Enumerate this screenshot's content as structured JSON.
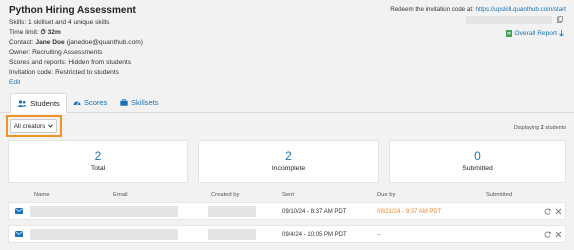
{
  "title": "Python Hiring Assessment",
  "info": {
    "skills": "Skills: 1 skillset and 4 unique skills",
    "time_limit_label": "Time limit:",
    "time_limit_value": "32m",
    "contact_label": "Contact:",
    "contact_name": "Jane Doe",
    "contact_email": "(janedoe@quanthub.com)",
    "owner": "Owner: Recruiting Assessments",
    "scores_reports": "Scores and reports: Hidden from students",
    "invitation_code": "Invitation code: Restricted to students",
    "edit": "Edit"
  },
  "redeem": {
    "label": "Redeem the invitation code at:",
    "url": "https://upskill.quanthub.com/start"
  },
  "overall_report": "Overall Report",
  "tabs": [
    {
      "label": "Students"
    },
    {
      "label": "Scores"
    },
    {
      "label": "Skillsets"
    }
  ],
  "filter": {
    "label": "All creators"
  },
  "displaying": {
    "prefix": "Displaying",
    "count": "2",
    "suffix": "students"
  },
  "stats": [
    {
      "value": "2",
      "label": "Total"
    },
    {
      "value": "2",
      "label": "Incomplete"
    },
    {
      "value": "0",
      "label": "Submitted"
    }
  ],
  "columns": [
    "Name",
    "Email",
    "Created by",
    "Sent",
    "Due by",
    "Submitted"
  ],
  "rows": [
    {
      "sent": "09/10/24 - 8:37 AM PDT",
      "due": "09/21/24 - 9:37 AM PDT",
      "submitted": ""
    },
    {
      "sent": "09/4/24 - 10:05 PM PDT",
      "due": "--",
      "submitted": ""
    }
  ],
  "colors": {
    "accent": "#1a73b8",
    "highlight": "#f29423",
    "due_warning": "#e8892d",
    "report_icon": "#3fa34d"
  },
  "icons": [
    "users-icon",
    "gauge-icon",
    "briefcase-icon",
    "chevron-down-icon",
    "copy-icon",
    "report-file-icon",
    "download-arrow-icon",
    "envelope-icon",
    "refresh-icon",
    "close-icon"
  ]
}
